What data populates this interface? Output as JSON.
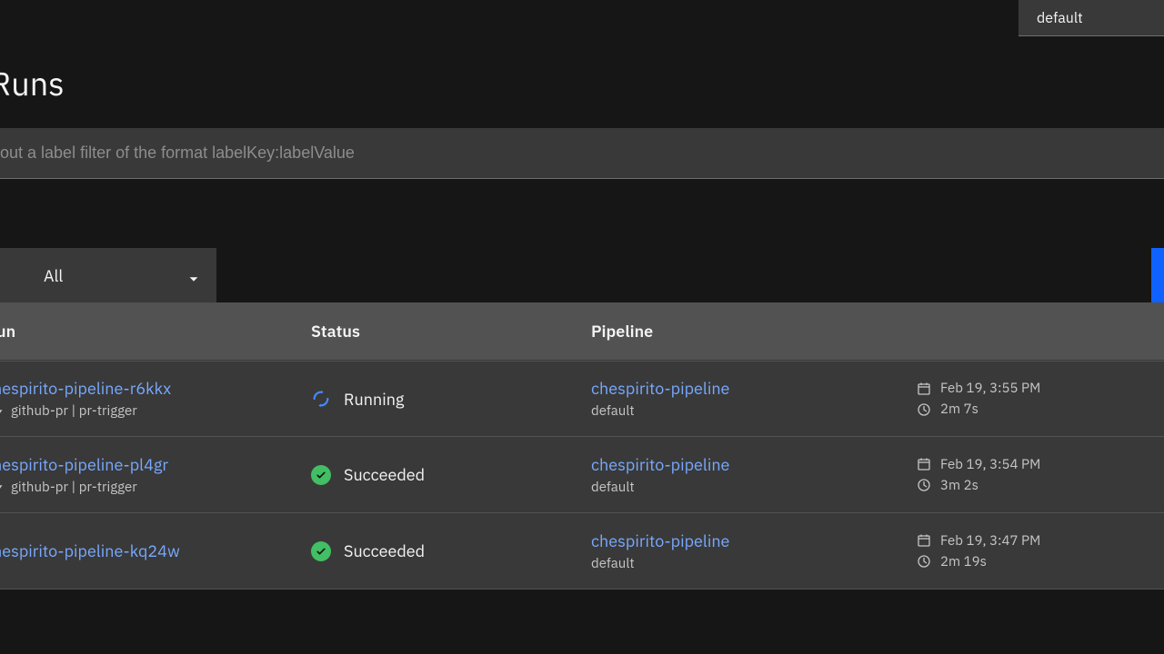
{
  "topbar": {
    "namespace": "default"
  },
  "page": {
    "title": "ineRuns"
  },
  "filter": {
    "placeholder": "out a label filter of the format labelKey:labelValue",
    "value": ""
  },
  "toolbar": {
    "status_filter": "All"
  },
  "table": {
    "headers": {
      "run": "un",
      "status": "Status",
      "pipeline": "Pipeline"
    },
    "rows": [
      {
        "run": {
          "name": "hespirito-pipeline-r6kkx",
          "trigger": "github-pr | pr-trigger"
        },
        "status": {
          "state": "running",
          "label": "Running"
        },
        "pipeline": {
          "name": "chespirito-pipeline",
          "ns": "default"
        },
        "time": {
          "created": "Feb 19, 3:55 PM",
          "duration": "2m 7s"
        }
      },
      {
        "run": {
          "name": "hespirito-pipeline-pl4gr",
          "trigger": "github-pr | pr-trigger"
        },
        "status": {
          "state": "succeeded",
          "label": "Succeeded"
        },
        "pipeline": {
          "name": "chespirito-pipeline",
          "ns": "default"
        },
        "time": {
          "created": "Feb 19, 3:54 PM",
          "duration": "3m 2s"
        }
      },
      {
        "run": {
          "name": "hespirito-pipeline-kq24w",
          "trigger": ""
        },
        "status": {
          "state": "succeeded",
          "label": "Succeeded"
        },
        "pipeline": {
          "name": "chespirito-pipeline",
          "ns": "default"
        },
        "time": {
          "created": "Feb 19, 3:47 PM",
          "duration": "2m 19s"
        }
      }
    ]
  }
}
